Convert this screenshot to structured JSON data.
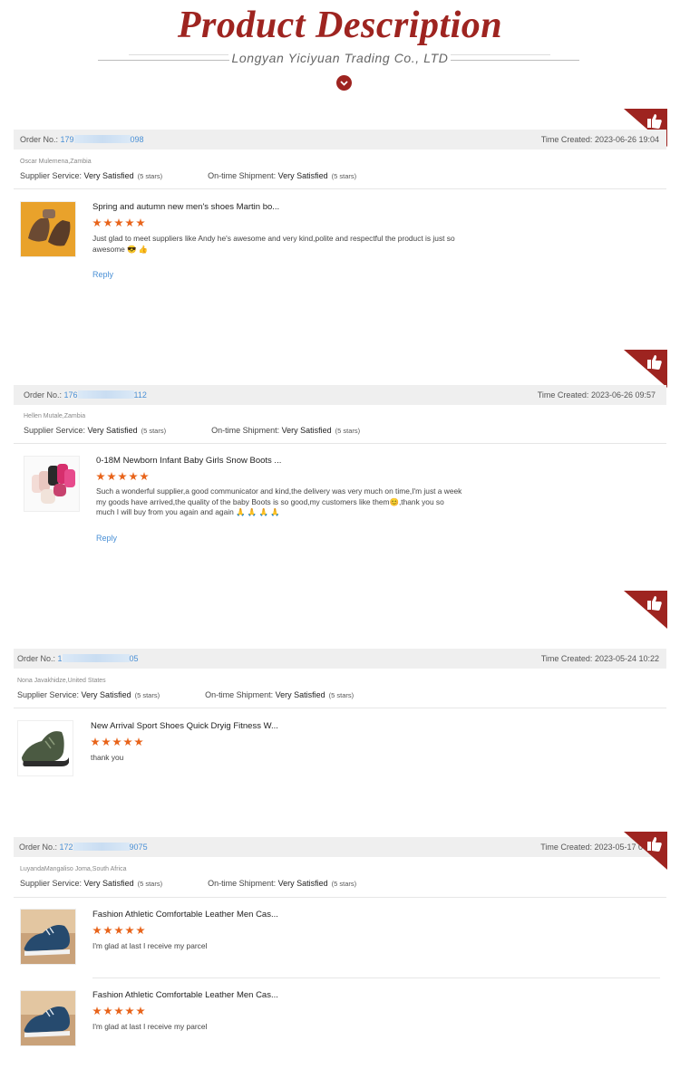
{
  "header": {
    "title": "Product Description",
    "subtitle": "Longyan Yiciyuan Trading Co., LTD"
  },
  "labels": {
    "order_no": "Order No.: ",
    "time_created": "Time Created: ",
    "supplier_service": "Supplier Service: ",
    "ontime_shipment": "On-time Shipment: ",
    "very_satisfied": "Very Satisfied",
    "five_stars": "(5 stars)",
    "reply": "Reply"
  },
  "reviews": [
    {
      "order_prefix": "179",
      "order_suffix": "098",
      "time": "2023-06-26 19:04",
      "buyer": "Oscar Mulemena,Zambia",
      "items": [
        {
          "title": "Spring and autumn new men's shoes Martin bo...",
          "rating": 5,
          "text": "Just glad to meet suppliers like Andy he's awesome and very kind,polite and respectful the product is just so awesome 😎 👍",
          "reply": "Reply"
        }
      ]
    },
    {
      "order_prefix": "176",
      "order_suffix": "112",
      "time": "2023-06-26 09:57",
      "buyer": "Hellen Mutale,Zambia",
      "items": [
        {
          "title": "0-18M Newborn Infant Baby Girls Snow Boots ...",
          "rating": 5,
          "text": "Such a wonderful supplier,a good communicator and kind,the delivery was very much on time,I'm just a week my goods have arrived,the quality of the baby Boots is so good,my customers like them😊,thank you so much I will buy from you again and again 🙏 🙏 🙏 🙏",
          "reply": "Reply"
        }
      ]
    },
    {
      "order_prefix": "1",
      "order_suffix": "05",
      "time": "2023-05-24 10:22",
      "buyer": "Nona Javakhidze,United States",
      "items": [
        {
          "title": "New Arrival Sport Shoes Quick Dryig Fitness W...",
          "rating": 5,
          "text": "thank you"
        }
      ]
    },
    {
      "order_prefix": "172",
      "order_suffix": "9075",
      "time": "2023-05-17 0",
      "buyer": "LuyandaMangaliso Joma,South Africa",
      "items": [
        {
          "title": "Fashion Athletic Comfortable Leather Men Cas...",
          "rating": 5,
          "text": "I'm glad at last I receive my parcel"
        },
        {
          "title": "Fashion Athletic Comfortable Leather Men Cas...",
          "rating": 5,
          "text": "I'm glad at last I receive my parcel"
        }
      ]
    }
  ],
  "colors": {
    "brand": "#9e2420",
    "link": "#4a90d6",
    "star": "#e8641b"
  },
  "icons": [
    "chevron-down-icon",
    "thumbs-up-icon",
    "star-icon"
  ]
}
